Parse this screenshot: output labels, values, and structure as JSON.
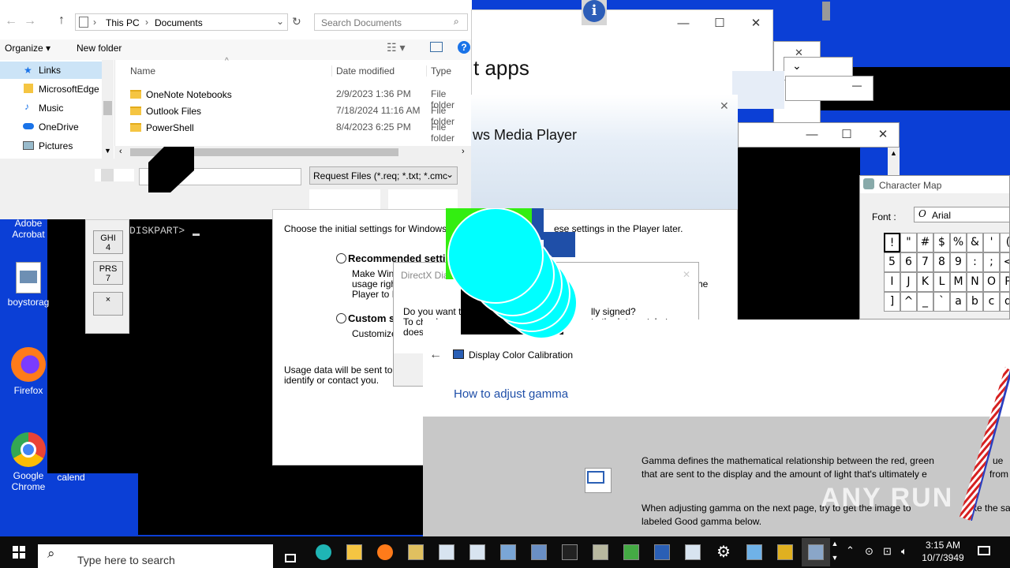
{
  "explorer": {
    "breadcrumb": [
      "This PC",
      "Documents"
    ],
    "search_placeholder": "Search Documents",
    "organize": "Organize",
    "new_folder": "New folder",
    "nav_items": [
      "Links",
      "MicrosoftEdge",
      "Music",
      "OneDrive",
      "Pictures"
    ],
    "columns": [
      "Name",
      "Date modified",
      "Type"
    ],
    "rows": [
      {
        "name": "OneNote Notebooks",
        "date": "2/9/2023 1:36 PM",
        "type": "File folder"
      },
      {
        "name": "Outlook Files",
        "date": "7/18/2024 11:16 AM",
        "type": "File folder"
      },
      {
        "name": "PowerShell",
        "date": "8/4/2023 6:25 PM",
        "type": "File folder"
      }
    ],
    "file_type_filter": "Request Files (*.req; *.txt; *.cmc"
  },
  "settings_window": {
    "heading_fragment": "t apps"
  },
  "wmp": {
    "title_fragment": "ws Media Player",
    "intro": "Choose the initial settings for Windows Med",
    "intro_right": "ese settings in the Player later.",
    "recommended": "Recommended setting",
    "recommended_desc": [
      "Make Wind",
      "usage right",
      "Player to M"
    ],
    "recommended_desc_right": "he",
    "custom": "Custom se",
    "custom_desc": "Customize",
    "usage_note": [
      "Usage data will be sent to Mi",
      "identify or contact you."
    ]
  },
  "directx": {
    "title": "DirectX Dia",
    "question": [
      "Do you want t",
      "To check your",
      "does"
    ],
    "question_right": [
      "lly signed?",
      "to the Internet, but"
    ]
  },
  "diskpart": {
    "prompt": "DISKPART> "
  },
  "keypad": [
    {
      "top": "GHI",
      "bottom": "4"
    },
    {
      "top": "PRS",
      "bottom": "7"
    },
    {
      "top": "×",
      "bottom": ""
    }
  ],
  "charmap": {
    "title": "Character Map",
    "font_label": "Font :",
    "font_value": "Arial",
    "rows": [
      [
        "!",
        "\"",
        "#",
        "$",
        "%",
        "&",
        "'",
        "("
      ],
      [
        "5",
        "6",
        "7",
        "8",
        "9",
        ":",
        ";",
        "<"
      ],
      [
        "I",
        "J",
        "K",
        "L",
        "M",
        "N",
        "O",
        "P"
      ],
      [
        "]",
        "^",
        "_",
        "`",
        "a",
        "b",
        "c",
        "d"
      ]
    ]
  },
  "calibration": {
    "title": "Display Color Calibration",
    "heading": "How to adjust gamma",
    "para1": [
      "Gamma defines the mathematical relationship between the red, green",
      "that are sent to the display and the amount of light that's ultimately e"
    ],
    "para1_right": [
      "ue",
      "from"
    ],
    "para2": [
      "When adjusting gamma on the next page, try to get the image to",
      "labeled Good gamma below."
    ],
    "para2_right": "ke the sa"
  },
  "desktop_icons": [
    {
      "label": "Adobe Acrobat",
      "icon": "acrobat-icon"
    },
    {
      "label": "boystorag",
      "icon": "image-file-icon"
    },
    {
      "label": "Firefox",
      "icon": "firefox-icon"
    },
    {
      "label": "Google Chrome",
      "icon": "chrome-icon"
    },
    {
      "label": "calend",
      "icon": "calendar-icon"
    }
  ],
  "taskbar": {
    "search_placeholder": "Type here to search",
    "time": "3:15 AM",
    "date": "10/7/3949"
  },
  "watermark": "ANY RUN",
  "colors": {
    "desktop": "#0b3fd6",
    "accent": "#0063b1",
    "cyan": "#00ffff",
    "lime": "#33ee11"
  }
}
